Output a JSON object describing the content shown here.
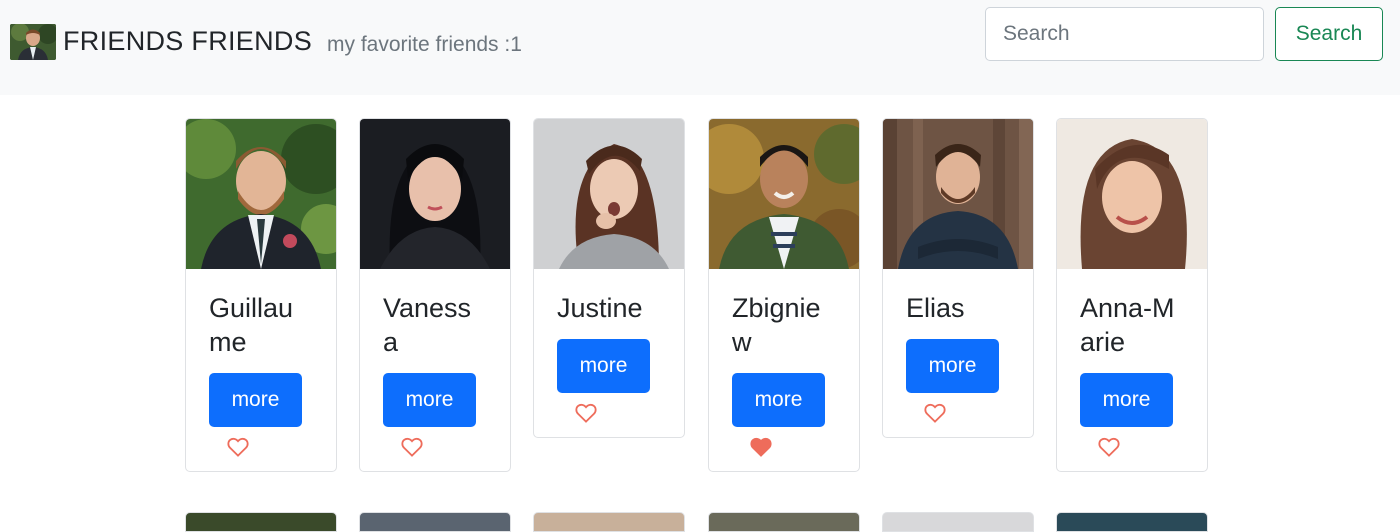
{
  "navbar": {
    "brand_title": "FRIENDS FRIENDS",
    "subtitle": "my favorite friends :1",
    "search_placeholder": "Search",
    "search_button": "Search"
  },
  "colors": {
    "primary": "#0d6efd",
    "success": "#198754",
    "heart": "#ee6c5b",
    "navbar_bg": "#f8f9fa"
  },
  "friends": [
    {
      "name": "Guillaume",
      "more_label": "more",
      "favorite": false
    },
    {
      "name": "Vanessa",
      "more_label": "more",
      "favorite": false
    },
    {
      "name": "Justine",
      "more_label": "more",
      "favorite": false
    },
    {
      "name": "Zbigniew",
      "more_label": "more",
      "favorite": true
    },
    {
      "name": "Elias",
      "more_label": "more",
      "favorite": false
    },
    {
      "name": "Anna-Marie",
      "more_label": "more",
      "favorite": false
    }
  ]
}
